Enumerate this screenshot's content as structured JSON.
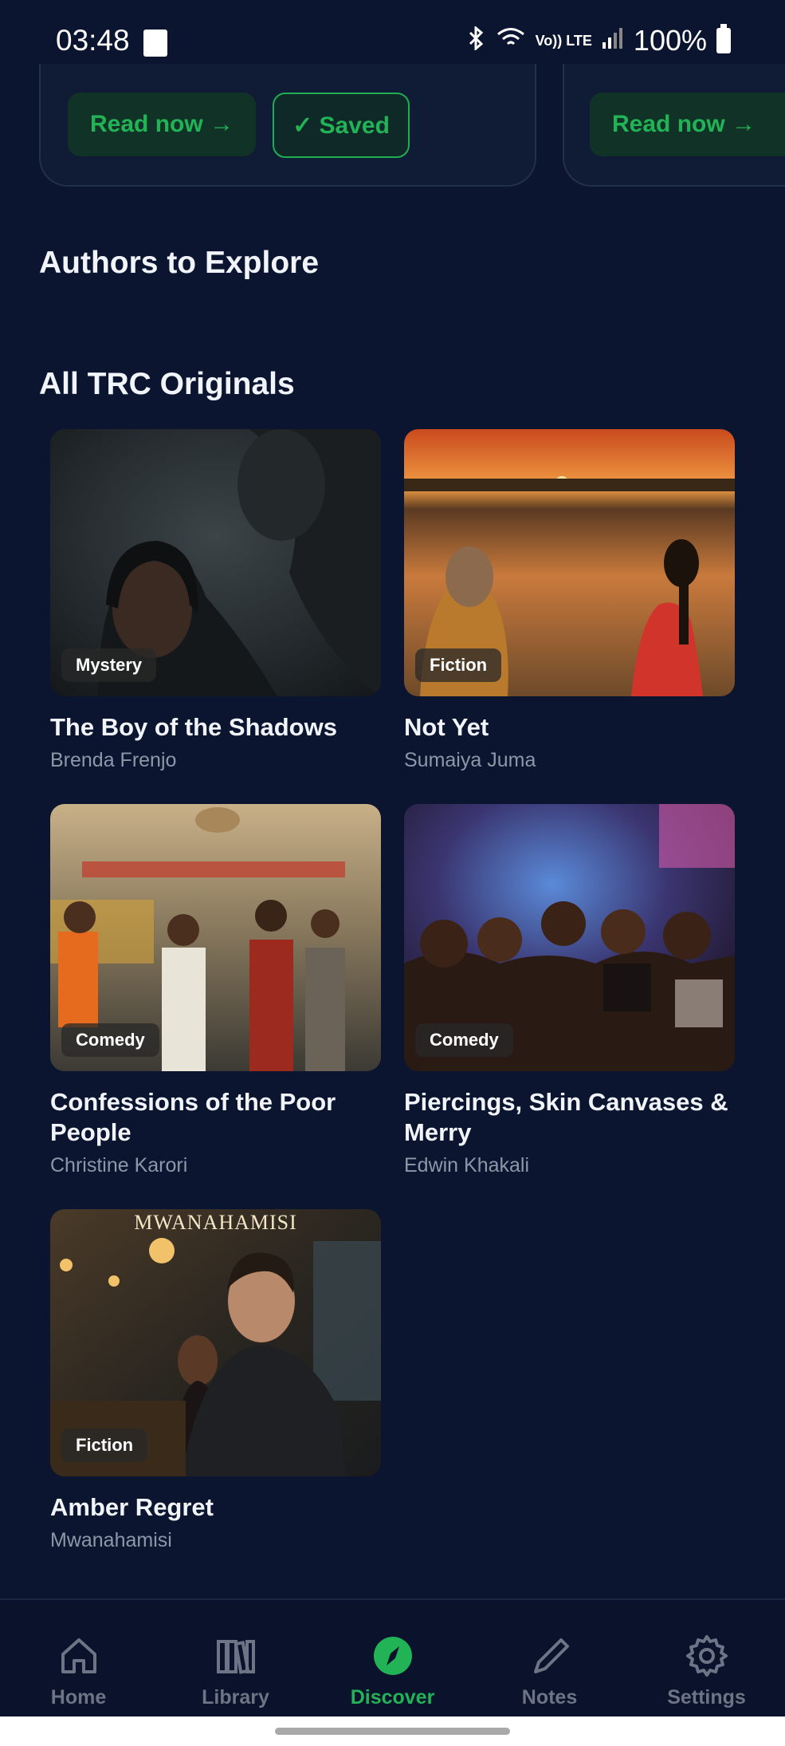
{
  "status_bar": {
    "time": "03:48",
    "battery": "100%",
    "net_label": "Vo)) LTE"
  },
  "top_cards": {
    "read_now": "Read now →",
    "saved": "✓ Saved"
  },
  "sections": {
    "authors": "Authors to Explore",
    "originals": "All TRC Originals"
  },
  "books": [
    {
      "title": "The Boy of the Shadows",
      "author": "Brenda Frenjo",
      "tag": "Mystery"
    },
    {
      "title": "Not Yet",
      "author": "Sumaiya Juma",
      "tag": "Fiction"
    },
    {
      "title": "Confessions of the Poor People",
      "author": "Christine Karori",
      "tag": "Comedy"
    },
    {
      "title": "Piercings, Skin Canvases & Merry",
      "author": "Edwin Khakali",
      "tag": "Comedy"
    },
    {
      "title": "Amber Regret",
      "author": "Mwanahamisi",
      "tag": "Fiction",
      "cover_text": "MWANAHAMISI"
    }
  ],
  "nav": [
    {
      "label": "Home"
    },
    {
      "label": "Library"
    },
    {
      "label": "Discover",
      "active": true
    },
    {
      "label": "Notes"
    },
    {
      "label": "Settings"
    }
  ],
  "colors": {
    "accent": "#22b356",
    "background": "#0b1530",
    "muted": "#8e97a8"
  }
}
